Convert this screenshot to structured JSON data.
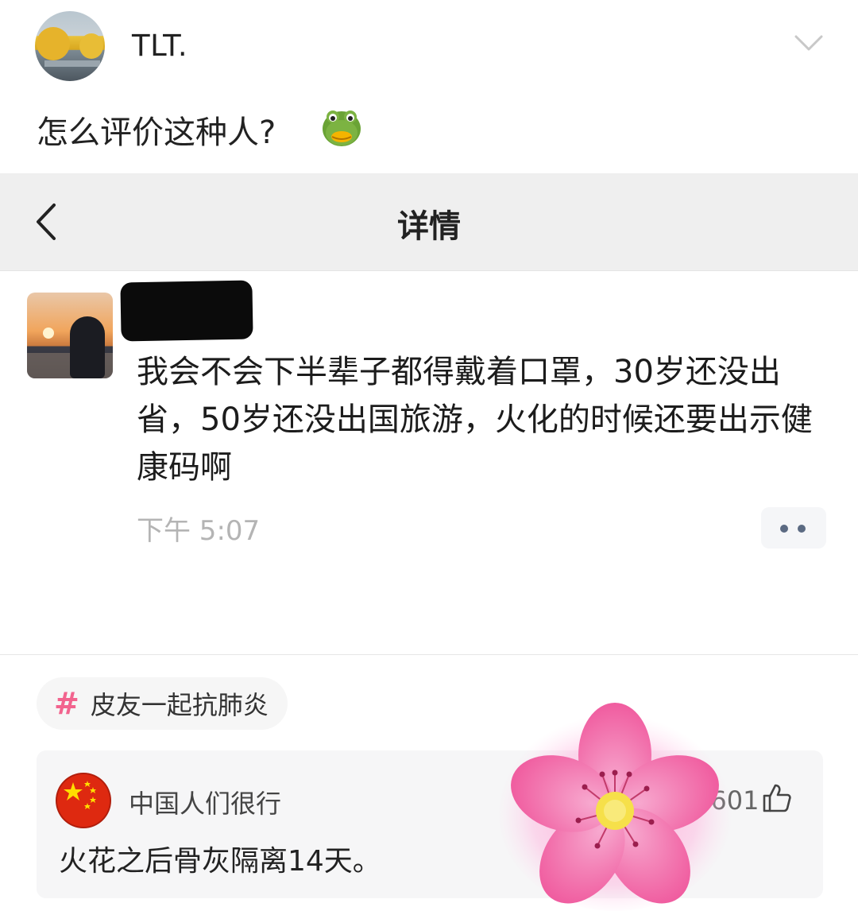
{
  "post": {
    "username": "TLT.",
    "text": "怎么评价这种人?",
    "emoji": "frog-face-emoji"
  },
  "screenshot": {
    "header_title": "详情",
    "weibo_text": "我会不会下半辈子都得戴着口罩，30岁还没出省，50岁还没出国旅游，火化的时候还要出示健康码啊",
    "time": "下午 5:07"
  },
  "topic": {
    "label": "皮友一起抗肺炎"
  },
  "top_comment": {
    "username": "中国人们很行",
    "text": "火花之后骨灰隔离14天。",
    "likes": "3601"
  },
  "colors": {
    "header_bg": "#efefef",
    "hash_pink": "#f2648e",
    "flag_red": "#de2910",
    "muted_text": "#b4b4b4"
  },
  "icons": [
    "chevron-down-icon",
    "back-arrow-icon",
    "more-dots-icon",
    "hash-icon",
    "thumbs-up-icon",
    "cherry-blossom-sticker"
  ]
}
